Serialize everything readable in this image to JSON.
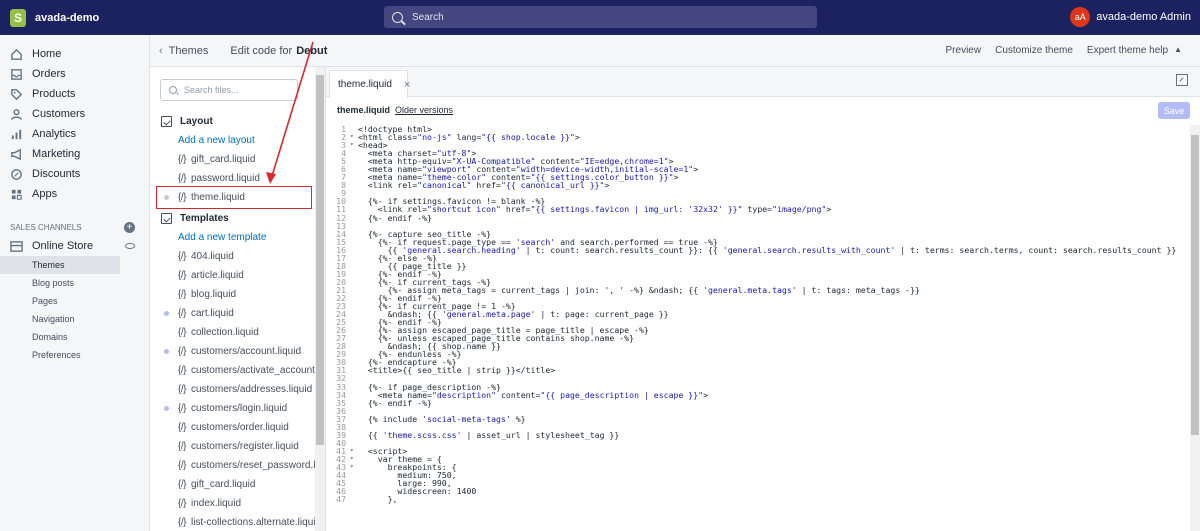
{
  "topbar": {
    "store_name": "avada-demo",
    "search_placeholder": "Search",
    "avatar_initials": "aA",
    "admin_name": "avada-demo Admin"
  },
  "nav": {
    "items": [
      {
        "label": "Home",
        "icon": "home-icon"
      },
      {
        "label": "Orders",
        "icon": "orders-icon"
      },
      {
        "label": "Products",
        "icon": "tag-icon"
      },
      {
        "label": "Customers",
        "icon": "customers-icon"
      },
      {
        "label": "Analytics",
        "icon": "analytics-icon"
      },
      {
        "label": "Marketing",
        "icon": "marketing-icon"
      },
      {
        "label": "Discounts",
        "icon": "discounts-icon"
      },
      {
        "label": "Apps",
        "icon": "apps-icon"
      }
    ],
    "channels_label": "SALES CHANNELS",
    "online_store": "Online Store",
    "subitems": [
      "Themes",
      "Blog posts",
      "Pages",
      "Navigation",
      "Domains",
      "Preferences"
    ]
  },
  "header": {
    "back_label": "Themes",
    "title_prefix": "Edit code for",
    "theme_name": "Debut",
    "preview": "Preview",
    "customize": "Customize theme",
    "help": "Expert theme help"
  },
  "tree": {
    "search_placeholder": "Search files...",
    "layout_folder": "Layout",
    "add_layout": "Add a new layout",
    "layout_files": [
      "gift_card.liquid",
      "password.liquid",
      "theme.liquid"
    ],
    "templates_folder": "Templates",
    "add_template": "Add a new template",
    "template_files": [
      "404.liquid",
      "article.liquid",
      "blog.liquid",
      "cart.liquid",
      "collection.liquid",
      "customers/account.liquid",
      "customers/activate_account.liquid",
      "customers/addresses.liquid",
      "customers/login.liquid",
      "customers/order.liquid",
      "customers/register.liquid",
      "customers/reset_password.liquid",
      "gift_card.liquid",
      "index.liquid",
      "list-collections.alternate.liquid"
    ]
  },
  "editor": {
    "tab_label": "theme.liquid",
    "close_glyph": "×",
    "file_name": "theme.liquid",
    "older_versions": "Older versions",
    "save_label": "Save"
  },
  "code_lines": [
    "<!doctype html>",
    "<html class=\"no-js\" lang=\"{{ shop.locale }}\">",
    "<head>",
    "  <meta charset=\"utf-8\">",
    "  <meta http-equiv=\"X-UA-Compatible\" content=\"IE=edge,chrome=1\">",
    "  <meta name=\"viewport\" content=\"width=device-width,initial-scale=1\">",
    "  <meta name=\"theme-color\" content=\"{{ settings.color_button }}\">",
    "  <link rel=\"canonical\" href=\"{{ canonical_url }}\">",
    "",
    "  {%- if settings.favicon != blank -%}",
    "    <link rel=\"shortcut icon\" href=\"{{ settings.favicon | img_url: '32x32' }}\" type=\"image/png\">",
    "  {%- endif -%}",
    "",
    "  {%- capture seo_title -%}",
    "    {%- if request.page_type == 'search' and search.performed == true -%}",
    "      {{ 'general.search.heading' | t: count: search.results_count }}: {{ 'general.search.results_with_count' | t: terms: search.terms, count: search.results_count }}",
    "    {%- else -%}",
    "      {{ page_title }}",
    "    {%- endif -%}",
    "    {%- if current_tags -%}",
    "      {%- assign meta_tags = current_tags | join: ', ' -%} &ndash; {{ 'general.meta.tags' | t: tags: meta_tags -}}",
    "    {%- endif -%}",
    "    {%- if current_page != 1 -%}",
    "      &ndash; {{ 'general.meta.page' | t: page: current_page }}",
    "    {%- endif -%}",
    "    {%- assign escaped_page_title = page_title | escape -%}",
    "    {%- unless escaped_page_title contains shop.name -%}",
    "      &ndash; {{ shop.name }}",
    "    {%- endunless -%}",
    "  {%- endcapture -%}",
    "  <title>{{ seo_title | strip }}</title>",
    "",
    "  {%- if page_description -%}",
    "    <meta name=\"description\" content=\"{{ page_description | escape }}\">",
    "  {%- endif -%}",
    "",
    "  {% include 'social-meta-tags' %}",
    "",
    "  {{ 'theme.scss.css' | asset_url | stylesheet_tag }}",
    "",
    "  <script>",
    "    var theme = {",
    "      breakpoints: {",
    "        medium: 750,",
    "        large: 990,",
    "        widescreen: 1400",
    "      },"
  ],
  "fold_lines": [
    2,
    3,
    41,
    42,
    43
  ],
  "colors": {
    "topbar": "#1c2260",
    "link": "#006fbb",
    "highlight": "#d7282f",
    "save_disabled": "#b3bcf5"
  }
}
